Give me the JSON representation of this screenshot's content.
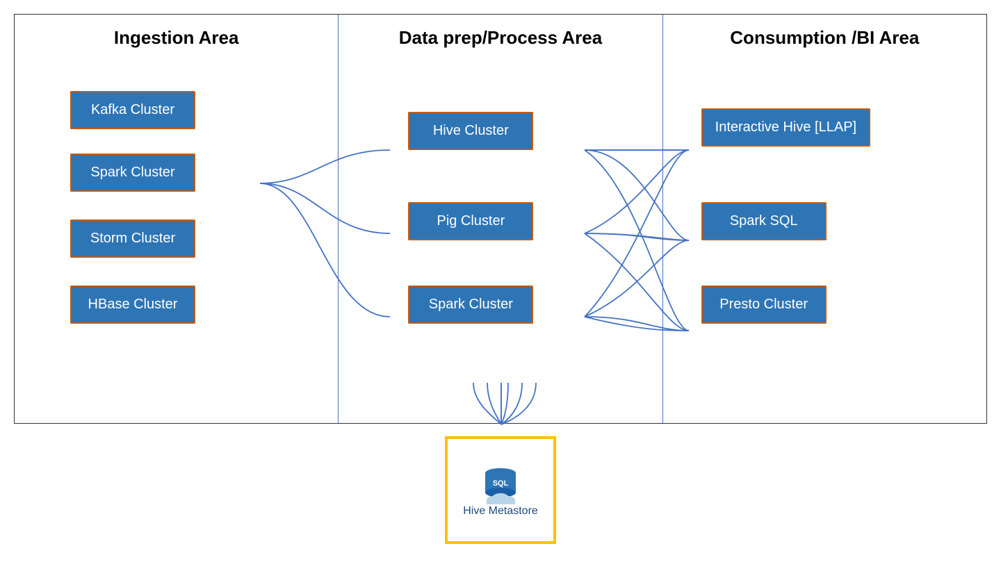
{
  "columns": [
    {
      "id": "ingestion",
      "title": "Ingestion Area"
    },
    {
      "id": "process",
      "title": "Data prep/Process Area"
    },
    {
      "id": "consumption",
      "title": "Consumption /BI Area"
    }
  ],
  "ingestion_clusters": [
    {
      "id": "kafka",
      "label": "Kafka Cluster"
    },
    {
      "id": "spark-in",
      "label": "Spark Cluster"
    },
    {
      "id": "storm",
      "label": "Storm Cluster"
    },
    {
      "id": "hbase",
      "label": "HBase Cluster"
    }
  ],
  "process_clusters": [
    {
      "id": "hive-proc",
      "label": "Hive Cluster"
    },
    {
      "id": "pig",
      "label": "Pig Cluster"
    },
    {
      "id": "spark-proc",
      "label": "Spark Cluster"
    }
  ],
  "consumption_clusters": [
    {
      "id": "int-hive",
      "label": "Interactive Hive [LLAP]"
    },
    {
      "id": "spark-sql",
      "label": "Spark SQL"
    },
    {
      "id": "presto",
      "label": "Presto Cluster"
    }
  ],
  "metastore": {
    "label": "Hive Metastore"
  },
  "colors": {
    "cluster_bg": "#2e75b6",
    "cluster_border": "#c55a11",
    "line_color": "#4472c4",
    "metastore_border": "#ffc000"
  }
}
